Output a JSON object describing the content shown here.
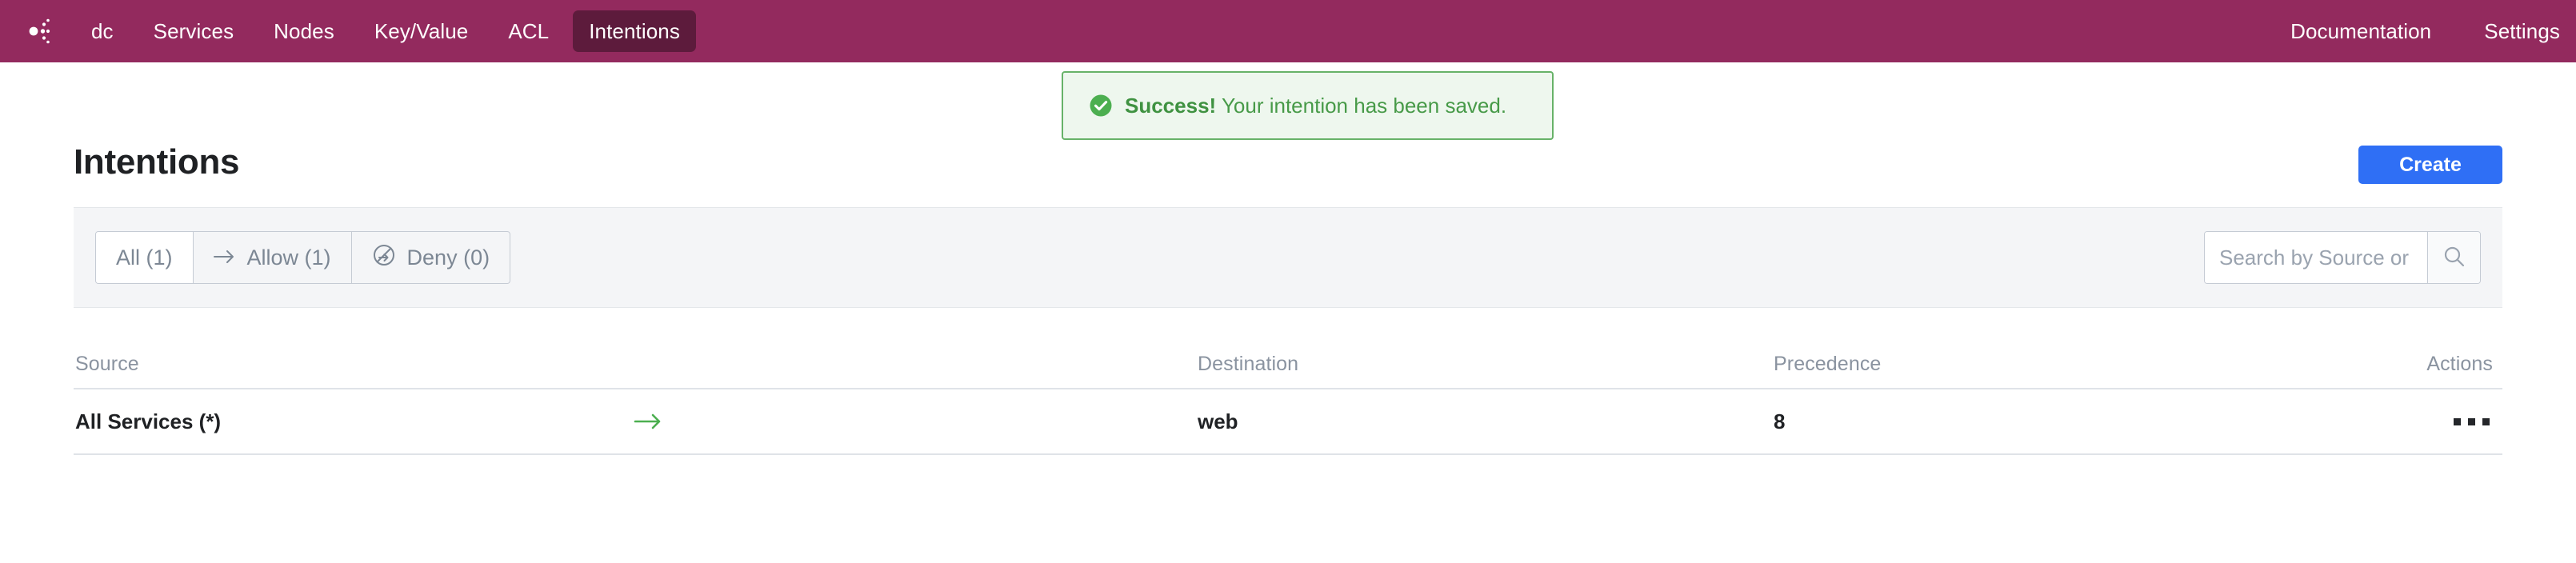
{
  "navbar": {
    "brand_icon": "consul-logo-icon",
    "brand_color": "#932a5e",
    "left_items": [
      {
        "label": "dc",
        "active": false
      },
      {
        "label": "Services",
        "active": false
      },
      {
        "label": "Nodes",
        "active": false
      },
      {
        "label": "Key/Value",
        "active": false
      },
      {
        "label": "ACL",
        "active": false
      },
      {
        "label": "Intentions",
        "active": true
      }
    ],
    "right_items": [
      {
        "label": "Documentation"
      },
      {
        "label": "Settings"
      }
    ]
  },
  "flash": {
    "icon": "check-circle-icon",
    "strong": "Success!",
    "message": "Your intention has been saved.",
    "color": "#479a48",
    "bg": "#eef7ee",
    "border": "#67b268"
  },
  "header": {
    "title": "Intentions",
    "create_label": "Create",
    "create_color": "#2f6ff5"
  },
  "filters": {
    "tabs": [
      {
        "label": "All (1)",
        "icon": "",
        "active": true
      },
      {
        "label": "Allow (1)",
        "icon": "arrow-right-icon",
        "active": false
      },
      {
        "label": "Deny (0)",
        "icon": "no-entry-arrow-icon",
        "active": false
      }
    ],
    "search": {
      "placeholder": "Search by Source or",
      "value": "",
      "button_icon": "search-icon"
    }
  },
  "table": {
    "columns": {
      "source": "Source",
      "destination": "Destination",
      "precedence": "Precedence",
      "actions": "Actions"
    },
    "rows": [
      {
        "source": "All Services (*)",
        "action_icon": "arrow-right-icon",
        "action_color": "#4caf50",
        "destination": "web",
        "precedence": "8",
        "menu_icon": "kebab-menu-icon"
      }
    ]
  }
}
